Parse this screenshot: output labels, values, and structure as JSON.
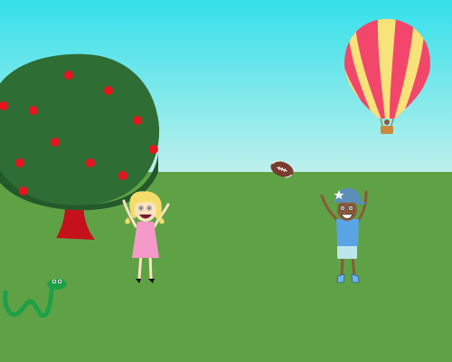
{
  "scene": {
    "colors": {
      "sky_top": "#33e0ea",
      "sky_bottom": "#bff0ec",
      "grass": "#5fa246",
      "tree_canopy": "#2e6d33",
      "tree_canopy_dark": "#24592a",
      "apple": "#e8141e",
      "trunk": "#c4111a",
      "balloon_red": "#f2476b",
      "balloon_yellow": "#f8e27a",
      "basket": "#c98a3c",
      "football": "#7a3b2e",
      "snake": "#1fa048",
      "girl_dress": "#f59ac8",
      "girl_hair": "#f4dd6a",
      "boy_shirt": "#5aa3e4",
      "boy_shorts": "#bde6ec",
      "boy_cap": "#5b8eb8",
      "skin_light": "#fde2c2",
      "skin_dark": "#8a5a3a"
    },
    "icons": {
      "apple_tree": "apple-tree-icon",
      "hot_air_balloon": "hot-air-balloon-icon",
      "football": "football-icon",
      "snake": "snake-icon",
      "girl": "girl-character-icon",
      "boy": "boy-character-icon",
      "star": "star-icon"
    }
  }
}
